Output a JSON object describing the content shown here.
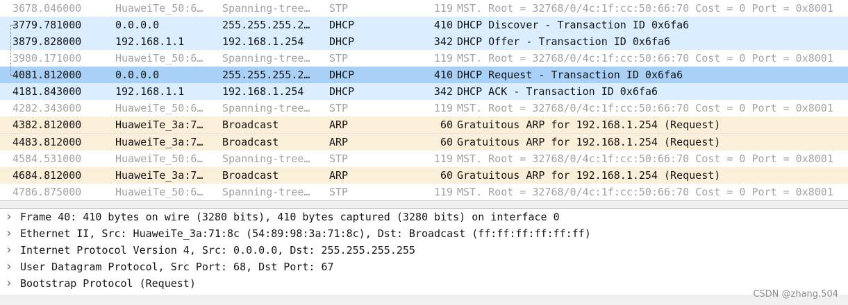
{
  "packets": [
    {
      "no": "36",
      "time": "78.046000",
      "src": "HuaweiTe_50:6…",
      "dst": "Spanning-tree…",
      "proto": "STP",
      "len": "119",
      "info": "MST. Root = 32768/0/4c:1f:cc:50:66:70  Cost = 0  Port = 0x8001",
      "kind": "stp"
    },
    {
      "no": "37",
      "time": "79.781000",
      "src": "0.0.0.0",
      "dst": "255.255.255.2…",
      "proto": "DHCP",
      "len": "410",
      "info": "DHCP Discover - Transaction ID 0x6fa6",
      "kind": "dhcp"
    },
    {
      "no": "38",
      "time": "79.828000",
      "src": "192.168.1.1",
      "dst": "192.168.1.254",
      "proto": "DHCP",
      "len": "342",
      "info": "DHCP Offer    - Transaction ID 0x6fa6",
      "kind": "dhcp"
    },
    {
      "no": "39",
      "time": "80.171000",
      "src": "HuaweiTe_50:6…",
      "dst": "Spanning-tree…",
      "proto": "STP",
      "len": "119",
      "info": "MST. Root = 32768/0/4c:1f:cc:50:66:70  Cost = 0  Port = 0x8001",
      "kind": "stp"
    },
    {
      "no": "40",
      "time": "81.812000",
      "src": "0.0.0.0",
      "dst": "255.255.255.2…",
      "proto": "DHCP",
      "len": "410",
      "info": "DHCP Request  - Transaction ID 0x6fa6",
      "kind": "dhcp selected"
    },
    {
      "no": "41",
      "time": "81.843000",
      "src": "192.168.1.1",
      "dst": "192.168.1.254",
      "proto": "DHCP",
      "len": "342",
      "info": "DHCP ACK      - Transaction ID 0x6fa6",
      "kind": "dhcp"
    },
    {
      "no": "42",
      "time": "82.343000",
      "src": "HuaweiTe_50:6…",
      "dst": "Spanning-tree…",
      "proto": "STP",
      "len": "119",
      "info": "MST. Root = 32768/0/4c:1f:cc:50:66:70  Cost = 0  Port = 0x8001",
      "kind": "stp"
    },
    {
      "no": "43",
      "time": "82.812000",
      "src": "HuaweiTe_3a:7…",
      "dst": "Broadcast",
      "proto": "ARP",
      "len": "60",
      "info": "Gratuitous ARP for 192.168.1.254 (Request)",
      "kind": "arp divider"
    },
    {
      "no": "44",
      "time": "83.812000",
      "src": "HuaweiTe_3a:7…",
      "dst": "Broadcast",
      "proto": "ARP",
      "len": "60",
      "info": "Gratuitous ARP for 192.168.1.254 (Request)",
      "kind": "arp"
    },
    {
      "no": "45",
      "time": "84.531000",
      "src": "HuaweiTe_50:6…",
      "dst": "Spanning-tree…",
      "proto": "STP",
      "len": "119",
      "info": "MST. Root = 32768/0/4c:1f:cc:50:66:70  Cost = 0  Port = 0x8001",
      "kind": "stp"
    },
    {
      "no": "46",
      "time": "84.812000",
      "src": "HuaweiTe_3a:7…",
      "dst": "Broadcast",
      "proto": "ARP",
      "len": "60",
      "info": "Gratuitous ARP for 192.168.1.254 (Request)",
      "kind": "arp"
    },
    {
      "no": "47",
      "time": "86.875000",
      "src": "HuaweiTe_50:6…",
      "dst": "Spanning-tree…",
      "proto": "STP",
      "len": "119",
      "info": "MST. Root = 32768/0/4c:1f:cc:50:66:70  Cost = 0  Port = 0x8001",
      "kind": "stp"
    }
  ],
  "details": [
    {
      "text": "Frame 40: 410 bytes on wire (3280 bits), 410 bytes captured (3280 bits) on interface 0",
      "expander_icon": "chevron-right-icon"
    },
    {
      "text": "Ethernet II, Src: HuaweiTe_3a:71:8c (54:89:98:3a:71:8c), Dst: Broadcast (ff:ff:ff:ff:ff:ff)",
      "expander_icon": "chevron-right-icon"
    },
    {
      "text": "Internet Protocol Version 4, Src: 0.0.0.0, Dst: 255.255.255.255",
      "expander_icon": "chevron-right-icon"
    },
    {
      "text": "User Datagram Protocol, Src Port: 68, Dst Port: 67",
      "expander_icon": "chevron-right-icon"
    },
    {
      "text": "Bootstrap Protocol (Request)",
      "expander_icon": "chevron-right-icon"
    }
  ],
  "watermark": "CSDN @zhang.504",
  "colors": {
    "dhcp_row": "#daeeff",
    "selected_row": "#a9d1f7",
    "arp_row": "#fbefd9",
    "stp_text": "#a3a3a3"
  }
}
